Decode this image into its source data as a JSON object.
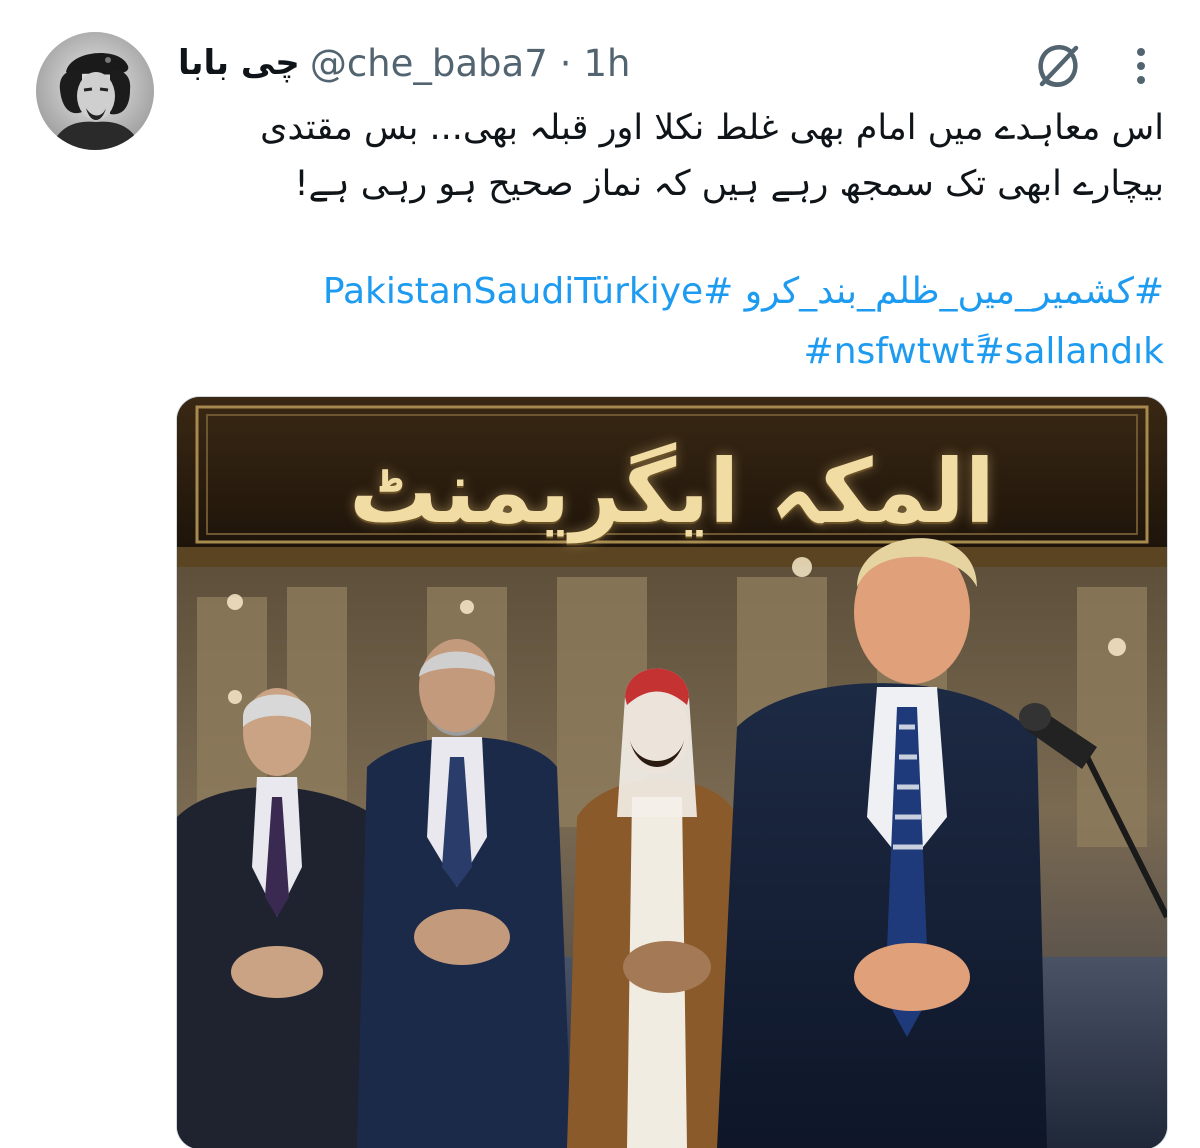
{
  "author": {
    "display_name": "چی بابا",
    "handle": "@che_baba7",
    "separator": "·",
    "time": "1h",
    "avatar_icon": "profile-photo"
  },
  "icons": {
    "grok": "grok-icon",
    "more": "more-options-icon"
  },
  "tweet": {
    "lines": [
      "اس معاہدے میں امام بھی غلط نکلا اور قبلہ بھی... بس مقتدی",
      "بیچارے ابھی تک سمجھ رہے ہیں کہ نماز صحیح ہو رہی ہے!"
    ],
    "hashtags_line1": {
      "left": "PakistanSaudiTürkiye#",
      "right": "#کشمیر_میں_ظلم_بند_کرو"
    },
    "hashtags_line2": {
      "left": "#nsfwtwtً",
      "right": "#sallandık"
    }
  },
  "media": {
    "banner_text": "المکہ ایگریمنٹ",
    "description": "image"
  },
  "colors": {
    "link": "#1d9bf0",
    "secondary_text": "#536471",
    "primary_text": "#0f1419"
  }
}
